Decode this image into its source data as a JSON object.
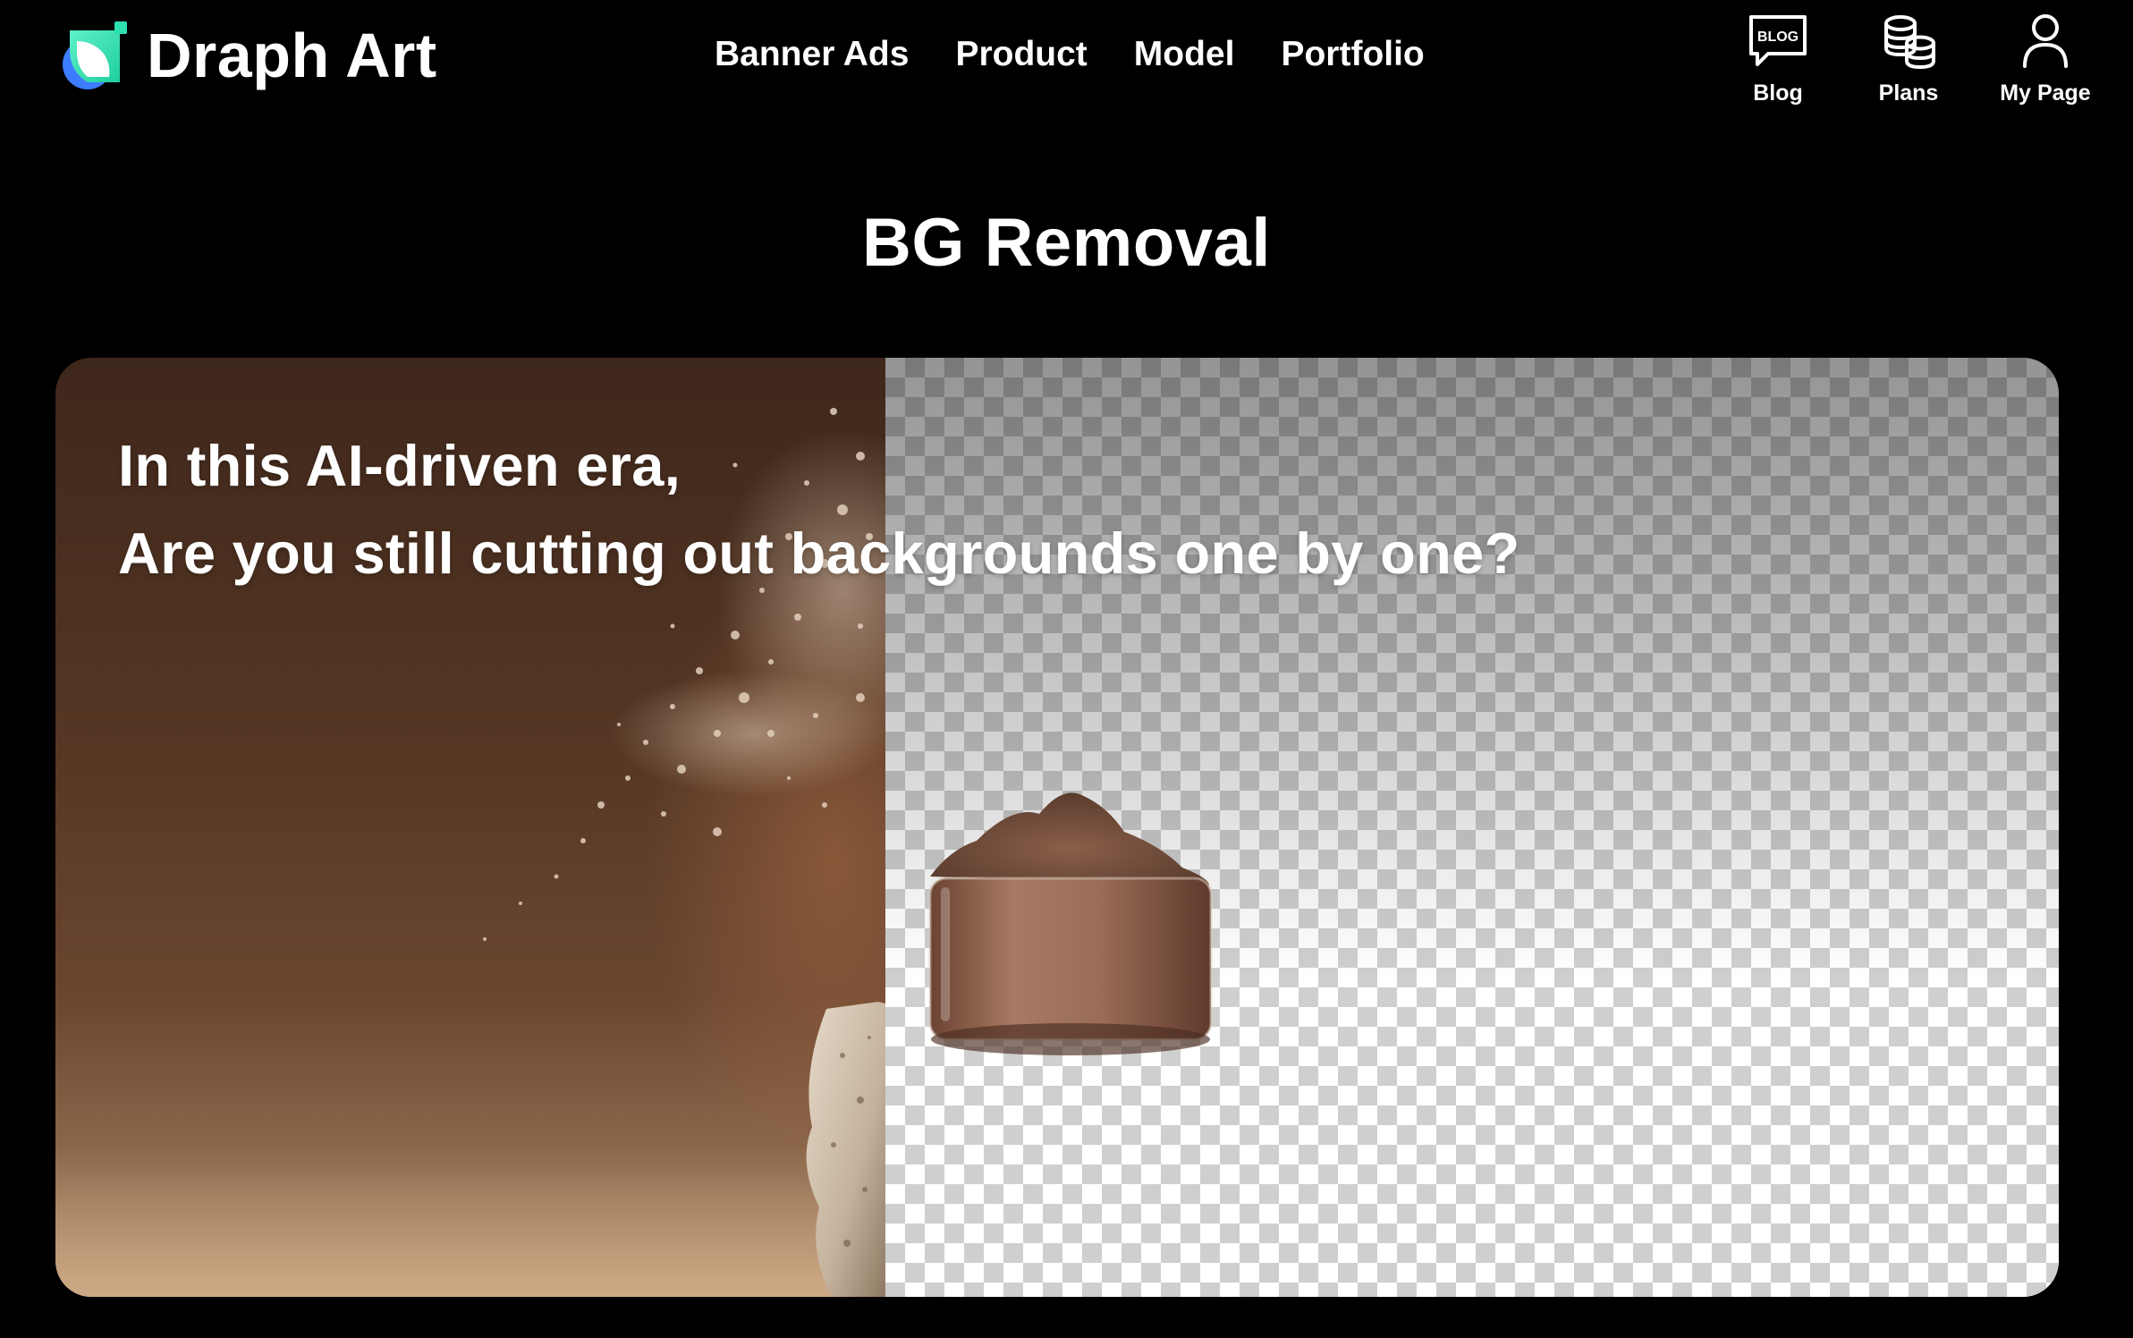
{
  "brand": {
    "name": "Draph Art",
    "logo_icon": "draph-logo-icon"
  },
  "nav": {
    "items": [
      {
        "label": "Banner Ads"
      },
      {
        "label": "Product"
      },
      {
        "label": "Model"
      },
      {
        "label": "Portfolio"
      }
    ]
  },
  "utility": {
    "blog": {
      "label": "Blog",
      "icon": "blog-icon",
      "icon_text": "BLOG"
    },
    "plans": {
      "label": "Plans",
      "icon": "coins-icon"
    },
    "my_page": {
      "label": "My Page",
      "icon": "user-icon"
    }
  },
  "page": {
    "title": "BG Removal"
  },
  "hero": {
    "headline_line_1": "In this AI-driven era,",
    "headline_line_2": "Are you still cutting out backgrounds one by one?",
    "left_image": "brown powder jar on stone with original background",
    "right_image": "same jar with transparent checkerboard background"
  },
  "colors": {
    "background": "#000000",
    "text": "#ffffff",
    "brand_teal": "#2ee0b0",
    "brand_blue": "#3d7cff",
    "checker_dark": "#cfcfcf",
    "checker_light": "#ffffff"
  }
}
